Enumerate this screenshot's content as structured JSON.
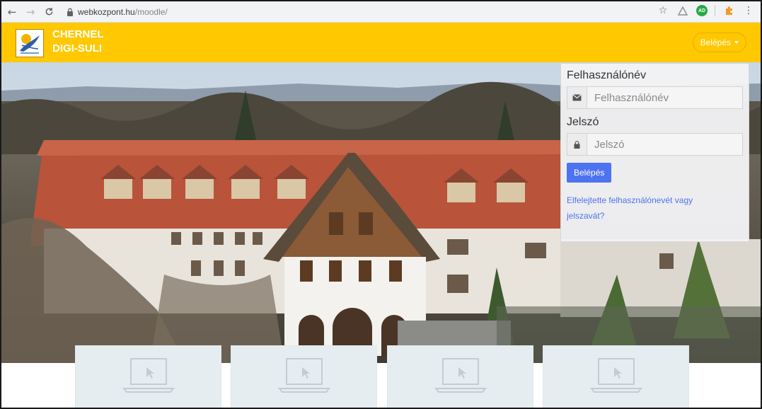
{
  "browser": {
    "url_domain": "webkozpont.hu",
    "url_path": "/moodle/",
    "ext_badge": "AD"
  },
  "navbar": {
    "site_name_line1": "CHERNEL",
    "site_name_line2": "DIGI-SULI",
    "login_toggle_label": "Belépés"
  },
  "login": {
    "username_label": "Felhasználónév",
    "username_placeholder": "Felhasználónév",
    "password_label": "Jelszó",
    "password_placeholder": "Jelszó",
    "submit_label": "Belépés",
    "forgot_link": "Elfelejtette felhasználónevét vagy jelszavát?"
  },
  "colors": {
    "brand_yellow": "#ffc800",
    "button_blue": "#4e73f0",
    "card_bg": "#e5edf1"
  },
  "icons": {
    "back": "arrow-left-icon",
    "forward": "arrow-right-icon",
    "reload": "reload-icon",
    "secure": "lock-icon",
    "bookmark": "star-icon",
    "username": "envelope-icon",
    "password": "lock-icon",
    "course_thumb": "laptop-icon"
  }
}
